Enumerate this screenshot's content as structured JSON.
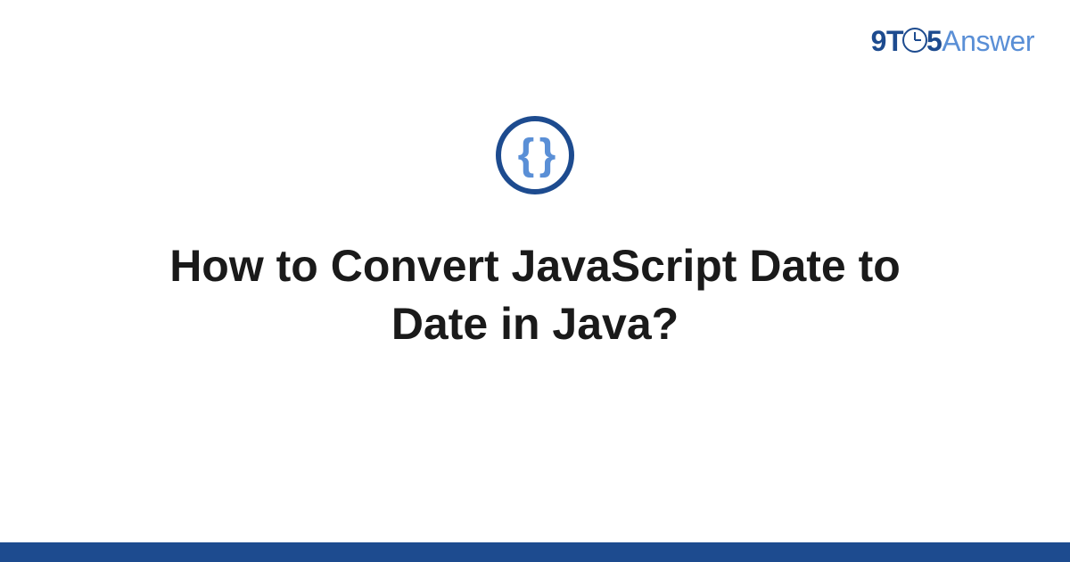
{
  "logo": {
    "prefix": "9T",
    "mid": "5",
    "suffix": "Answer"
  },
  "badge": {
    "symbol": "{ }",
    "name": "code-braces"
  },
  "title": "How to Convert JavaScript Date to Date in Java?",
  "colors": {
    "brand_dark": "#1d4b8f",
    "brand_light": "#5a8fd6"
  }
}
